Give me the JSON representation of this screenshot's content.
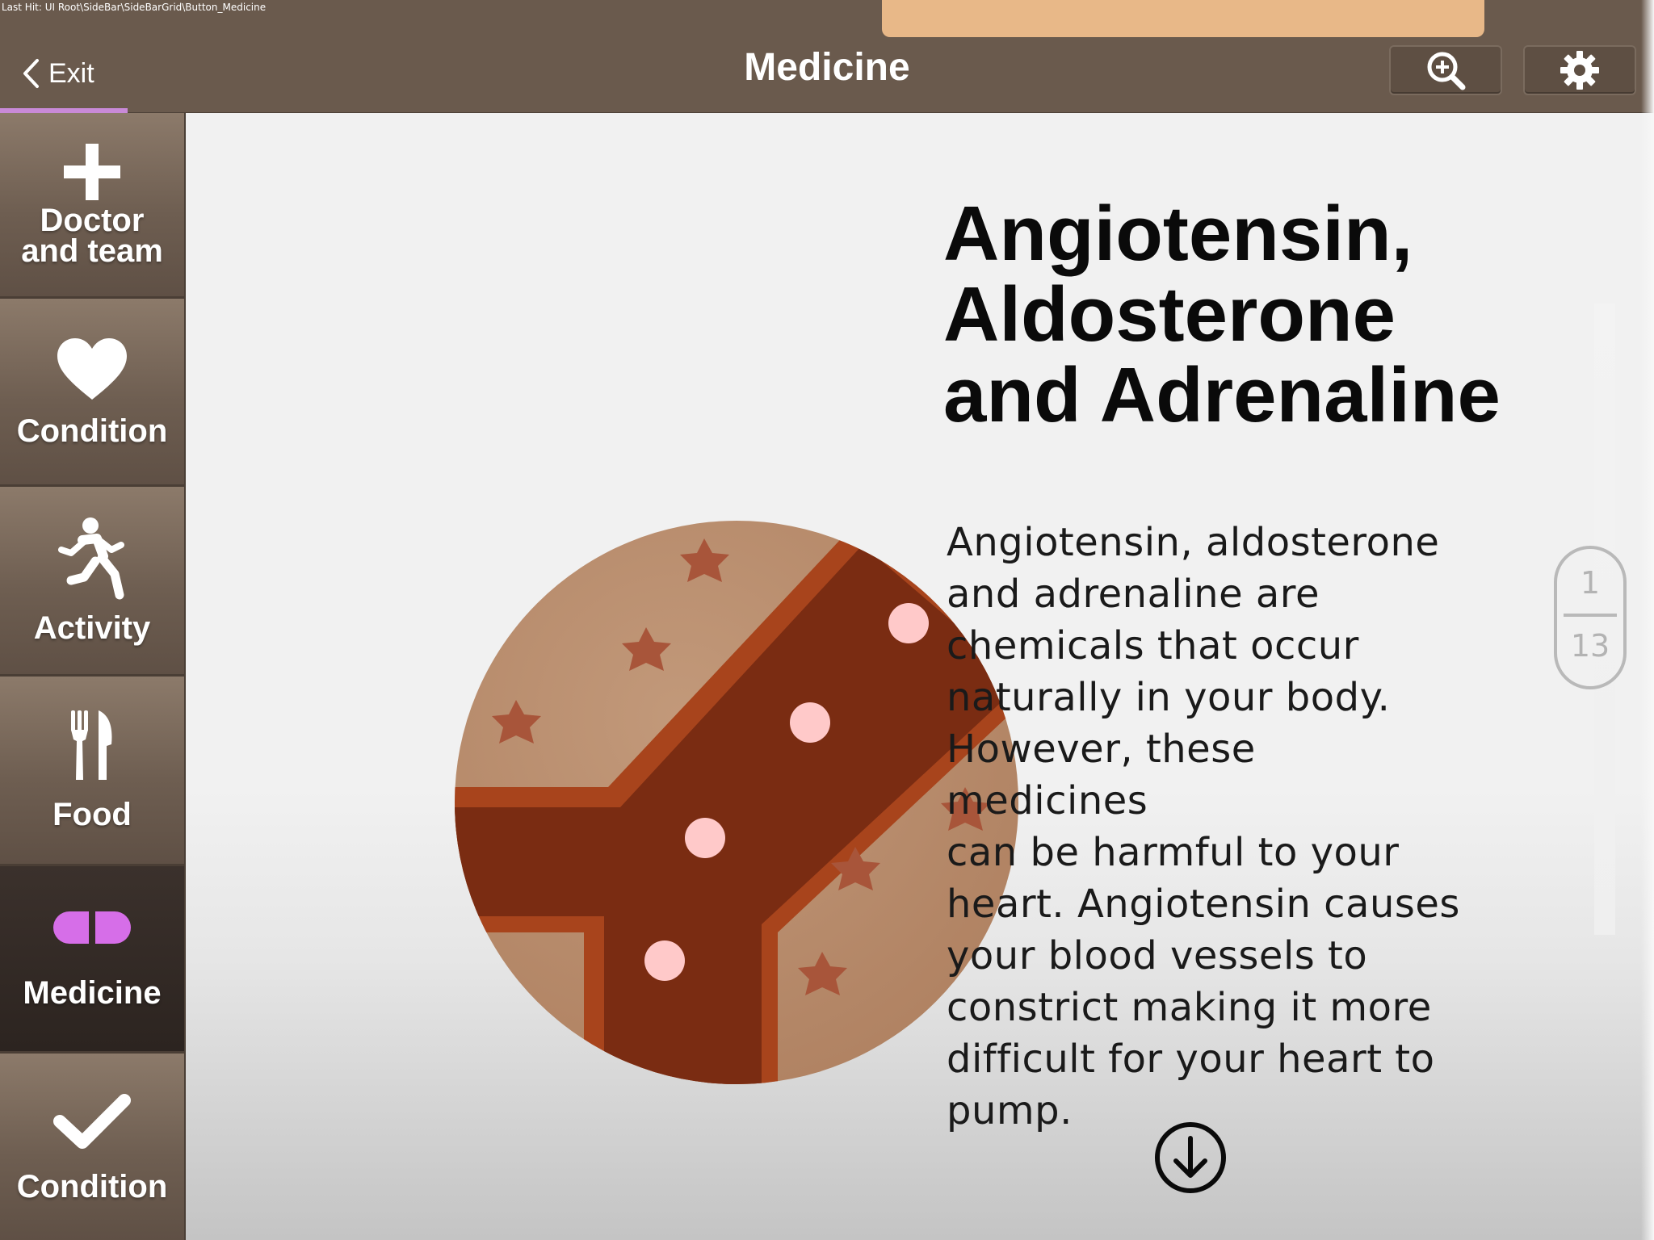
{
  "debug": {
    "last_hit": "Last Hit: UI Root\\SideBar\\SideBarGrid\\Button_Medicine"
  },
  "header": {
    "exit_label": "Exit",
    "title": "Medicine",
    "icons": {
      "back": "chevron-left-icon",
      "zoom": "zoom-in-icon",
      "settings": "gear-icon"
    }
  },
  "sidebar": {
    "active": "Medicine",
    "accent_color": "#d66ee8",
    "items": [
      {
        "label": "Doctor and team",
        "label_line1": "Doctor",
        "label_line2": "and team",
        "icon": "plus-icon"
      },
      {
        "label": "Condition",
        "icon": "heart-icon"
      },
      {
        "label": "Activity",
        "icon": "running-person-icon"
      },
      {
        "label": "Food",
        "icon": "fork-knife-icon"
      },
      {
        "label": "Medicine",
        "icon": "pill-icon"
      },
      {
        "label": "Condition",
        "icon": "checkmark-icon"
      }
    ]
  },
  "article": {
    "title_line1": "Angiotensin,",
    "title_line2": "Aldosterone",
    "title_line3": "and Adrenaline",
    "body_lines": [
      "Angiotensin, aldosterone",
      "and adrenaline are",
      "chemicals that occur",
      "naturally in your body.",
      "However, these medicines",
      "can be harmful to your",
      "heart. Angiotensin causes",
      "your blood vessels to",
      "constrict making it more",
      "difficult for your heart to",
      "pump."
    ],
    "illustration": "blood-vessel-illustration"
  },
  "pagination": {
    "current": "1",
    "total": "13"
  },
  "colors": {
    "topbar": "#6a5a4d",
    "sidebar_gradient_top": "#8c7a6a",
    "sidebar_gradient_bottom": "#5f5045",
    "sidebar_active": "#2c2420",
    "tissue": "#b98c68",
    "vessel": "#7a2c12",
    "vessel_edge": "#a9431b",
    "star": "#a9563a",
    "blood_cell": "#ffc7c7",
    "background": "#f1f1f1"
  }
}
